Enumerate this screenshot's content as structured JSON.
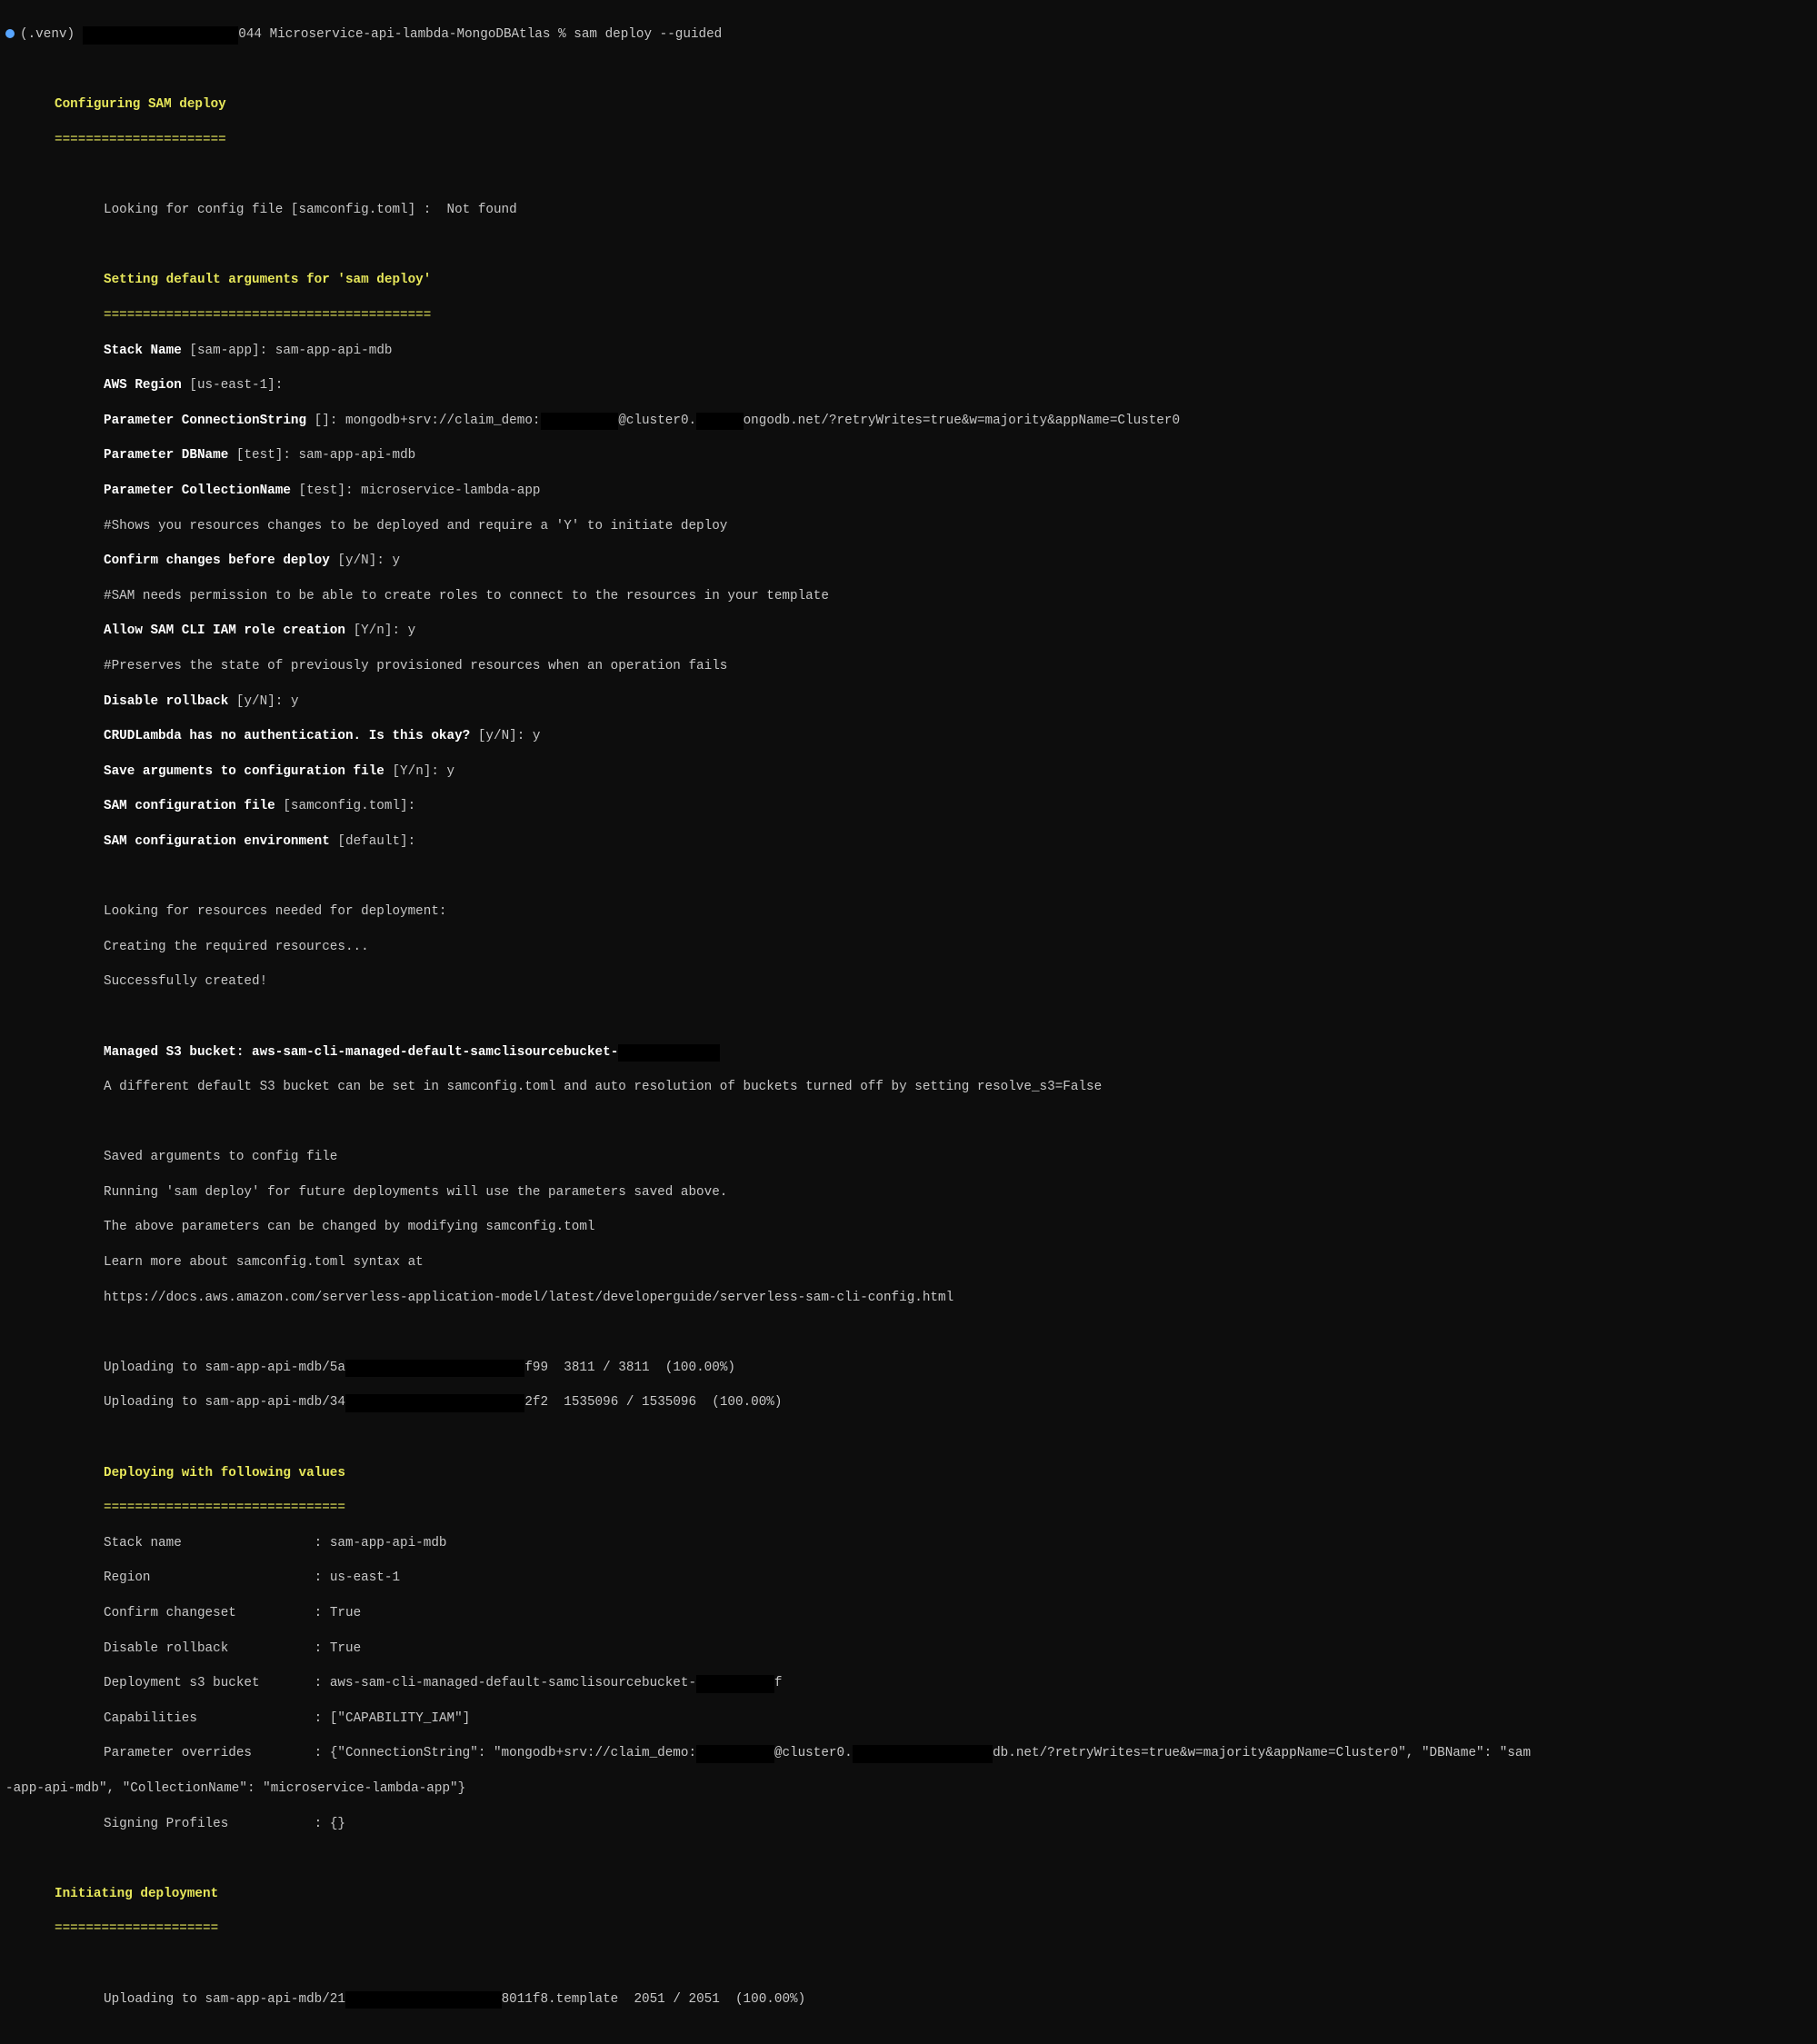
{
  "prompt": {
    "venv": "(.venv)",
    "host_suffix": "044",
    "dir": "Microservice-api-lambda-MongoDBAtlas",
    "sep": "%",
    "command": "sam deploy --guided"
  },
  "sections": {
    "configuring": {
      "title": "Configuring SAM deploy",
      "rule": "======================"
    },
    "setting_defaults": {
      "title": "Setting default arguments for 'sam deploy'",
      "rule": "=========================================="
    },
    "deploying_values": {
      "title": "Deploying with following values",
      "rule": "==============================="
    },
    "initiating": {
      "title": "Initiating deployment",
      "rule": "====================="
    }
  },
  "config_lookup": "Looking for config file [samconfig.toml] :  Not found",
  "args": {
    "stack_name_label": "Stack Name",
    "stack_name_default": "[sam-app]",
    "stack_name_value": "sam-app-api-mdb",
    "aws_region_label": "AWS Region",
    "aws_region_default": "[us-east-1]",
    "aws_region_value": "",
    "conn_label": "Parameter ConnectionString",
    "conn_default": "[]",
    "conn_prefix": "mongodb+srv://claim_demo:",
    "conn_mid": "@cluster0.",
    "conn_suffix": "ongodb.net/?retryWrites=true&w=majority&appName=Cluster0",
    "dbname_label": "Parameter DBName",
    "dbname_default": "[test]",
    "dbname_value": "sam-app-api-mdb",
    "coll_label": "Parameter CollectionName",
    "coll_default": "[test]",
    "coll_value": "microservice-lambda-app",
    "comment_confirm": "#Shows you resources changes to be deployed and require a 'Y' to initiate deploy",
    "confirm_label": "Confirm changes before deploy",
    "confirm_default": "[y/N]",
    "confirm_value": "y",
    "comment_iam": "#SAM needs permission to be able to create roles to connect to the resources in your template",
    "iam_label": "Allow SAM CLI IAM role creation",
    "iam_default": "[Y/n]",
    "iam_value": "y",
    "comment_rollback": "#Preserves the state of previously provisioned resources when an operation fails",
    "rollback_label": "Disable rollback",
    "rollback_default": "[y/N]",
    "rollback_value": "y",
    "crud_label": "CRUDLambda has no authentication. Is this okay?",
    "crud_default": "[y/N]",
    "crud_value": "y",
    "save_label": "Save arguments to configuration file",
    "save_default": "[Y/n]",
    "save_value": "y",
    "samfile_label": "SAM configuration file",
    "samfile_default": "[samconfig.toml]",
    "samfile_value": "",
    "samenv_label": "SAM configuration environment",
    "samenv_default": "[default]",
    "samenv_value": ""
  },
  "resources": [
    "Looking for resources needed for deployment:",
    "Creating the required resources...",
    "Successfully created!"
  ],
  "bucket": {
    "label": "Managed S3 bucket:",
    "name_prefix": "aws-sam-cli-managed-default-samclisourcebucket-",
    "note": "A different default S3 bucket can be set in samconfig.toml and auto resolution of buckets turned off by setting resolve_s3=False"
  },
  "post_notes": [
    "Saved arguments to config file",
    "Running 'sam deploy' for future deployments will use the parameters saved above.",
    "The above parameters can be changed by modifying samconfig.toml",
    "Learn more about samconfig.toml syntax at",
    "https://docs.aws.amazon.com/serverless-application-model/latest/developerguide/serverless-sam-cli-config.html"
  ],
  "uploads": [
    {
      "prefix": "Uploading to sam-app-api-mdb/5a",
      "mid": "f99",
      "stats": "3811 / 3811  (100.00%)"
    },
    {
      "prefix": "Uploading to sam-app-api-mdb/34",
      "mid": "2f2",
      "stats": "1535096 / 1535096  (100.00%)"
    }
  ],
  "deploy_values": {
    "stack_name": {
      "k": "Stack name",
      "v": "sam-app-api-mdb"
    },
    "region": {
      "k": "Region",
      "v": "us-east-1"
    },
    "confirm_cs": {
      "k": "Confirm changeset",
      "v": "True"
    },
    "disable_rollback": {
      "k": "Disable rollback",
      "v": "True"
    },
    "s3_bucket": {
      "k": "Deployment s3 bucket",
      "prefix": "aws-sam-cli-managed-default-samclisourcebucket-",
      "suffix": "f"
    },
    "capabilities": {
      "k": "Capabilities",
      "v": "[\"CAPABILITY_IAM\"]"
    },
    "param_overrides": {
      "k": "Parameter overrides",
      "p1": "{\"ConnectionString\": \"mongodb+srv://claim_demo:",
      "p2": "@cluster0.",
      "p3": "db.net/?retryWrites=true&w=majority&appName=Cluster0\", \"DBName\": \"sam",
      "p4": "-app-api-mdb\", \"CollectionName\": \"microservice-lambda-app\"}"
    },
    "signing": {
      "k": "Signing Profiles",
      "v": "{}"
    }
  },
  "final_upload": {
    "prefix": "Uploading to sam-app-api-mdb/21",
    "mid": "8011f8.template",
    "stats": "2051 / 2051  (100.00%)"
  }
}
